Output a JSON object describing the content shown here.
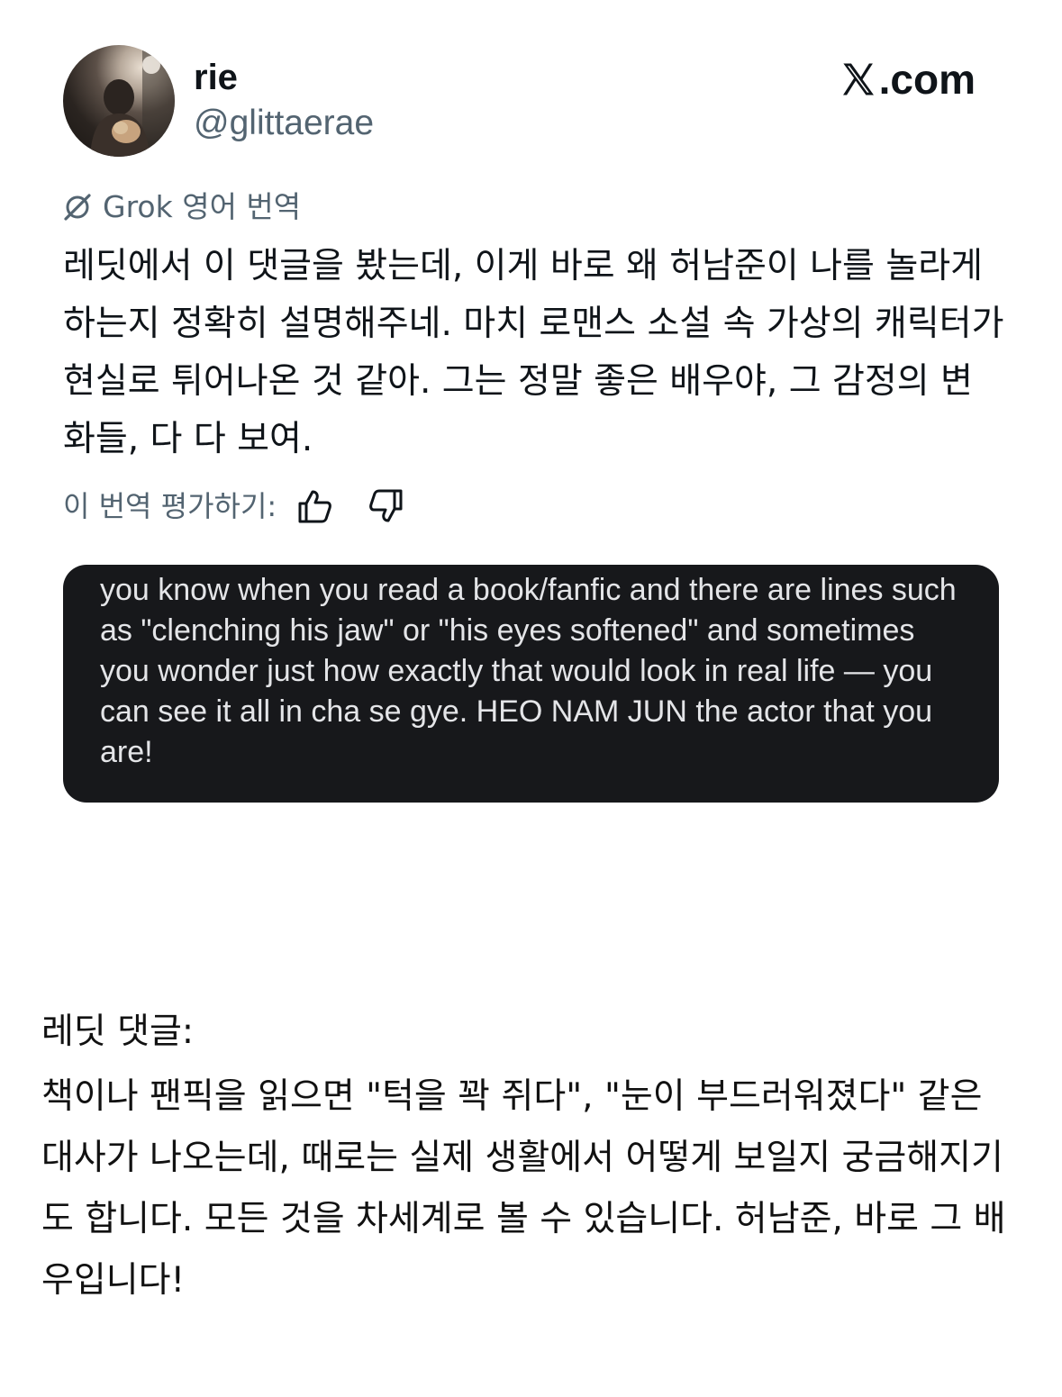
{
  "tweet": {
    "display_name": "rie",
    "handle": "@glittaerae",
    "brand": ".com",
    "avatar_icon": "profile-photo",
    "x_logo_icon": "x-logo-icon"
  },
  "translation": {
    "source_label": "Grok 영어 번역",
    "text": "레딧에서 이 댓글을 봤는데, 이게 바로 왜 허남준이 나를 놀라게 하는지 정확히 설명해주네. 마치 로맨스 소설 속 가상의 캐릭터가 현실로 튀어나온 것 같아. 그는 정말 좋은 배우야, 그 감정의 변화들, 다 다 보여.",
    "rate_label": "이 번역 평가하기:",
    "thumbs_up_icon": "thumbs-up-icon",
    "thumbs_down_icon": "thumbs-down-icon"
  },
  "quoted_comment": {
    "text": "you know when you read a book/fanfic and there are lines such as \"clenching his jaw\" or \"his eyes softened\" and sometimes you wonder just how exactly that would look in real life — you can see it all in cha se gye. HEO NAM JUN the actor that you are!",
    "background": "#17181b"
  },
  "reddit_translation": {
    "label": "레딧 댓글:",
    "text": "책이나 팬픽을 읽으면 \"턱을 꽉 쥐다\", \"눈이 부드러워졌다\" 같은 대사가 나오는데, 때로는 실제 생활에서 어떻게 보일지 궁금해지기도 합니다. 모든 것을 차세계로 볼 수 있습니다. 허남준, 바로 그 배우입니다!"
  }
}
